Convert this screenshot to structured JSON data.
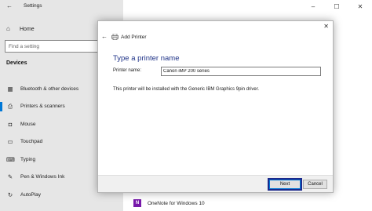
{
  "settings": {
    "title": "Settings",
    "home_label": "Home",
    "search_placeholder": "Find a setting",
    "section_header": "Devices",
    "nav_items": [
      {
        "label": "Bluetooth & other devices",
        "icon": "bluetooth-icon",
        "active": false
      },
      {
        "label": "Printers & scanners",
        "icon": "printer-icon",
        "active": true
      },
      {
        "label": "Mouse",
        "icon": "mouse-icon",
        "active": false
      },
      {
        "label": "Touchpad",
        "icon": "touchpad-icon",
        "active": false
      },
      {
        "label": "Typing",
        "icon": "keyboard-icon",
        "active": false
      },
      {
        "label": "Pen & Windows Ink",
        "icon": "pen-icon",
        "active": false
      },
      {
        "label": "AutoPlay",
        "icon": "autoplay-icon",
        "active": false
      }
    ],
    "onenote_label": "OneNote for Windows 10"
  },
  "dialog": {
    "title": "Add Printer",
    "heading": "Type a printer name",
    "name_label": "Printer name:",
    "name_value": "Canon iMP 200 series",
    "info_text": "This printer will be installed with the Generic IBM Graphics 9pin driver.",
    "next_label": "Next",
    "cancel_label": "Cancel"
  },
  "colors": {
    "accent": "#0078d7",
    "heading": "#1e3287",
    "sidebar_bg": "#e6e6e6",
    "focus_outline": "#1c2a8c"
  }
}
